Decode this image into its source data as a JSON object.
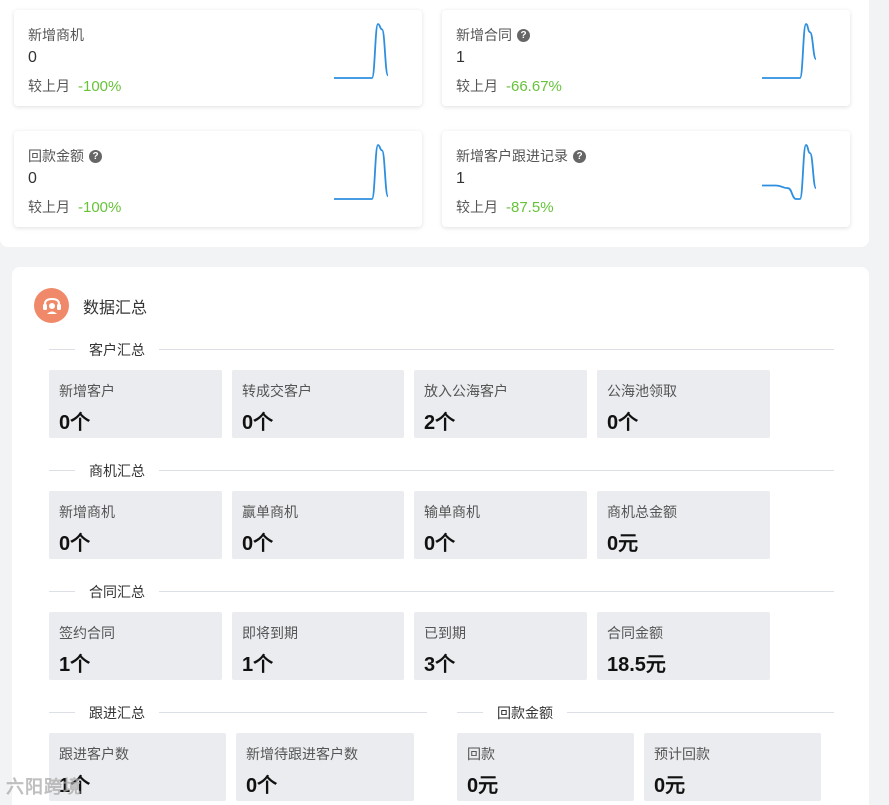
{
  "stats": [
    {
      "title": "新增商机",
      "help": false,
      "value": "0",
      "compare_label": "较上月",
      "change": "-100%",
      "trend": [
        0,
        0,
        0,
        0,
        0,
        1,
        0.9,
        0.05
      ]
    },
    {
      "title": "新增合同",
      "help": true,
      "value": "1",
      "compare_label": "较上月",
      "change": "-66.67%",
      "trend": [
        0,
        0,
        0,
        0,
        0,
        1,
        0.85,
        0.35
      ]
    },
    {
      "title": "回款金额",
      "help": true,
      "value": "0",
      "compare_label": "较上月",
      "change": "-100%",
      "trend": [
        0,
        0,
        0,
        0,
        0,
        1,
        0.9,
        0.05
      ]
    },
    {
      "title": "新增客户跟进记录",
      "help": true,
      "value": "1",
      "compare_label": "较上月",
      "change": "-87.5%",
      "trend": [
        0.25,
        0.25,
        0.2,
        0,
        0,
        1,
        0.85,
        0.2
      ]
    }
  ],
  "summary": {
    "title": "数据汇总",
    "customer": {
      "label": "客户汇总",
      "tiles": [
        {
          "label": "新增客户",
          "value": "0个"
        },
        {
          "label": "转成交客户",
          "value": "0个"
        },
        {
          "label": "放入公海客户",
          "value": "2个"
        },
        {
          "label": "公海池领取",
          "value": "0个"
        }
      ]
    },
    "opportunity": {
      "label": "商机汇总",
      "tiles": [
        {
          "label": "新增商机",
          "value": "0个"
        },
        {
          "label": "赢单商机",
          "value": "0个"
        },
        {
          "label": "输单商机",
          "value": "0个"
        },
        {
          "label": "商机总金额",
          "value": "0元"
        }
      ]
    },
    "contract": {
      "label": "合同汇总",
      "tiles": [
        {
          "label": "签约合同",
          "value": "1个"
        },
        {
          "label": "即将到期",
          "value": "1个"
        },
        {
          "label": "已到期",
          "value": "3个"
        },
        {
          "label": "合同金额",
          "value": "18.5元"
        }
      ]
    },
    "followup": {
      "label": "跟进汇总",
      "tiles": [
        {
          "label": "跟进客户数",
          "value": "1个"
        },
        {
          "label": "新增待跟进客户数",
          "value": "0个"
        }
      ]
    },
    "payment": {
      "label": "回款金额",
      "tiles": [
        {
          "label": "回款",
          "value": "0元"
        },
        {
          "label": "预计回款",
          "value": "0元"
        }
      ]
    }
  },
  "watermark": "六阳跨境",
  "colors": {
    "sparkline": "#2e8fdf",
    "positive_change": "#67c23a",
    "tile_bg": "#ebecef",
    "avatar_bg": "#f0896a"
  }
}
